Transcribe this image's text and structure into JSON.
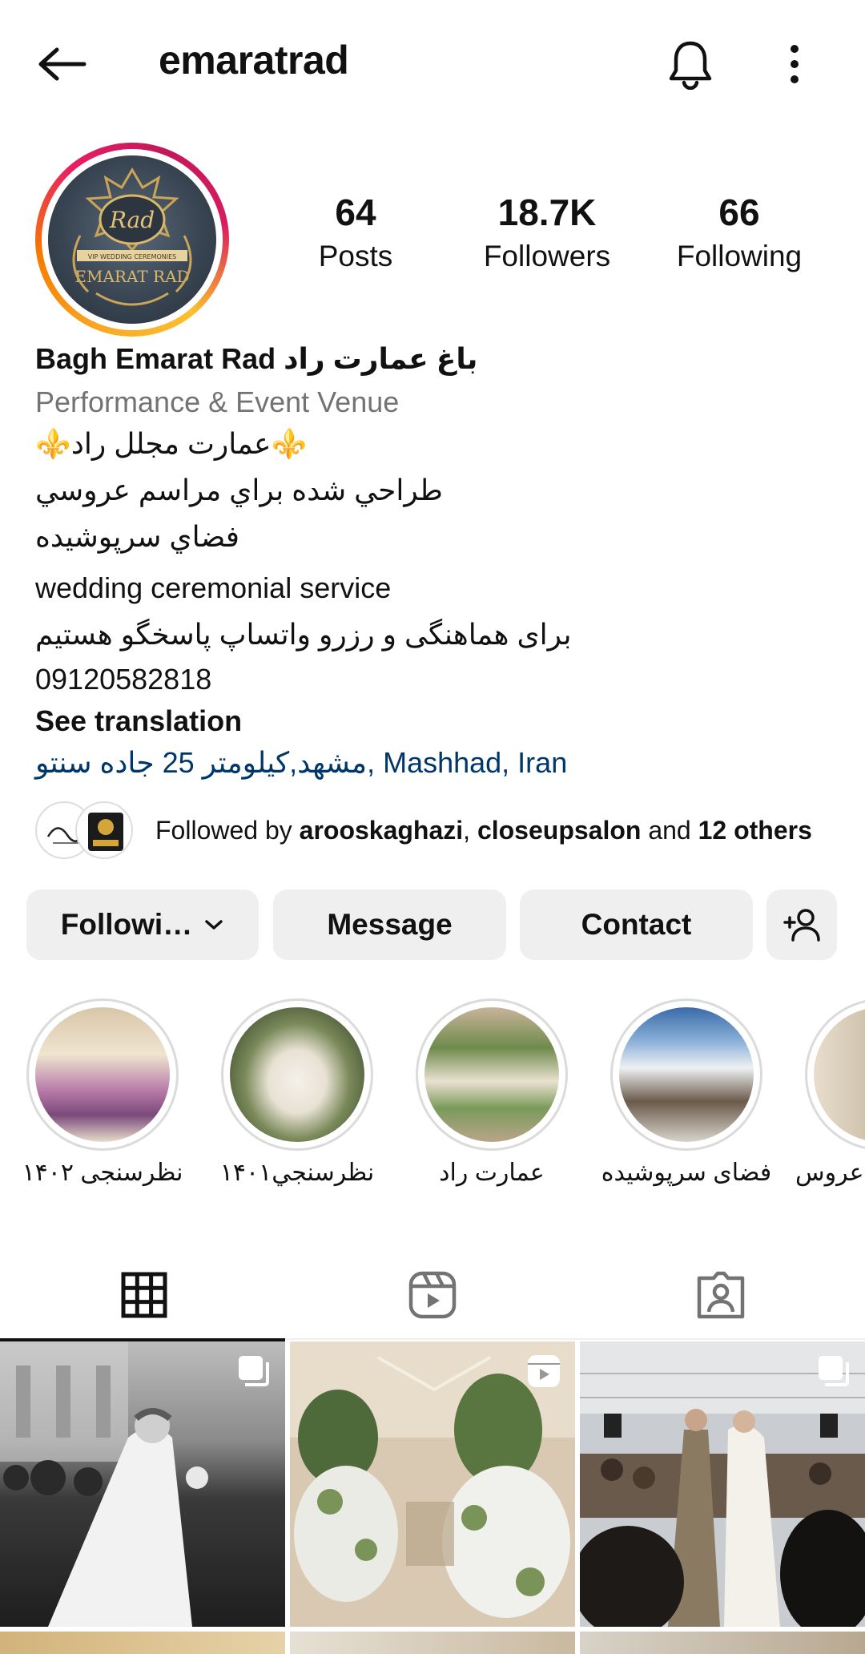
{
  "topbar": {
    "username": "emaratrad"
  },
  "icons": {
    "back": "arrow-left-icon",
    "bell": "bell-icon",
    "more": "more-vertical-icon"
  },
  "profile": {
    "avatar_text_top": "Rad",
    "avatar_text_bottom": "EMARAT RAD",
    "avatar_ribbon": "VIP WEDDING CEREMONIES",
    "stats": {
      "posts_count": "64",
      "posts_label": "Posts",
      "followers_count": "18.7K",
      "followers_label": "Followers",
      "following_count": "66",
      "following_label": "Following"
    },
    "name": "Bagh Emarat Rad باغ عمارت راد",
    "category": "Performance & Event Venue",
    "bio_lines": [
      "⚜️عمارت مجلل راد⚜️",
      "طراحي شده براي مراسم عروسي",
      "فضاي سرپوشيده",
      "wedding ceremonial service",
      "برای هماهنگی و رزرو واتساپ پاسخگو هستیم",
      "09120582818"
    ],
    "see_translation": "See translation",
    "location": "مشهد,کیلومتر 25 جاده سنتو, Mashhad, Iran"
  },
  "followed_by": {
    "prefix": "Followed by ",
    "user1": "arooskaghazi",
    "sep": ", ",
    "user2": "closeupsalon",
    "and": " and ",
    "others": "12 others"
  },
  "buttons": {
    "following": "Followi…",
    "message": "Message",
    "contact": "Contact"
  },
  "highlights": [
    {
      "label": "نظرسنجی ۱۴۰۲"
    },
    {
      "label": "نظرسنجي۱۴۰۱"
    },
    {
      "label": "عمارت راد"
    },
    {
      "label": "فضای سرپوشیده"
    },
    {
      "label": "عروس"
    }
  ],
  "tabs": [
    {
      "name": "grid-icon",
      "selected": true
    },
    {
      "name": "reels-icon",
      "selected": false
    },
    {
      "name": "tagged-icon",
      "selected": false
    }
  ],
  "posts": [
    {
      "type": "carousel",
      "icon": "carousel-icon"
    },
    {
      "type": "reel",
      "icon": "reel-icon"
    },
    {
      "type": "carousel",
      "icon": "carousel-icon"
    }
  ],
  "colors": {
    "link": "#00376b",
    "muted": "#737373",
    "button_bg": "#efefef"
  }
}
